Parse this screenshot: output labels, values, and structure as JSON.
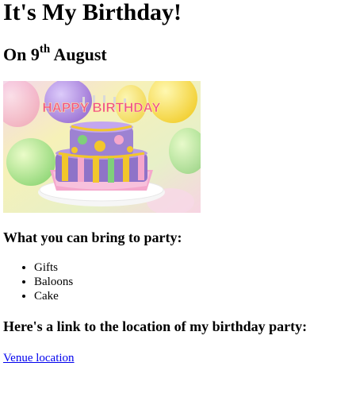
{
  "page": {
    "title": "It's My Birthday!",
    "date_prefix": "On 9",
    "date_suffix": "th",
    "date_month": "August",
    "image_text": "HAPPY BIRTHDAY",
    "bring_heading": "What you can bring to party:",
    "bring_items": [
      "Gifts",
      "Baloons",
      "Cake"
    ],
    "link_heading": "Here's a link to the location of my birthday party:",
    "link_text": "Venue location"
  },
  "colors": {
    "link": "#0000ee",
    "cake_purple": "#9b7bc6",
    "cake_yellow": "#f1c232",
    "cake_pink": "#f7a8c8",
    "cake_green": "#7fd07a"
  },
  "icons": {
    "image": "birthday-cake-image"
  }
}
